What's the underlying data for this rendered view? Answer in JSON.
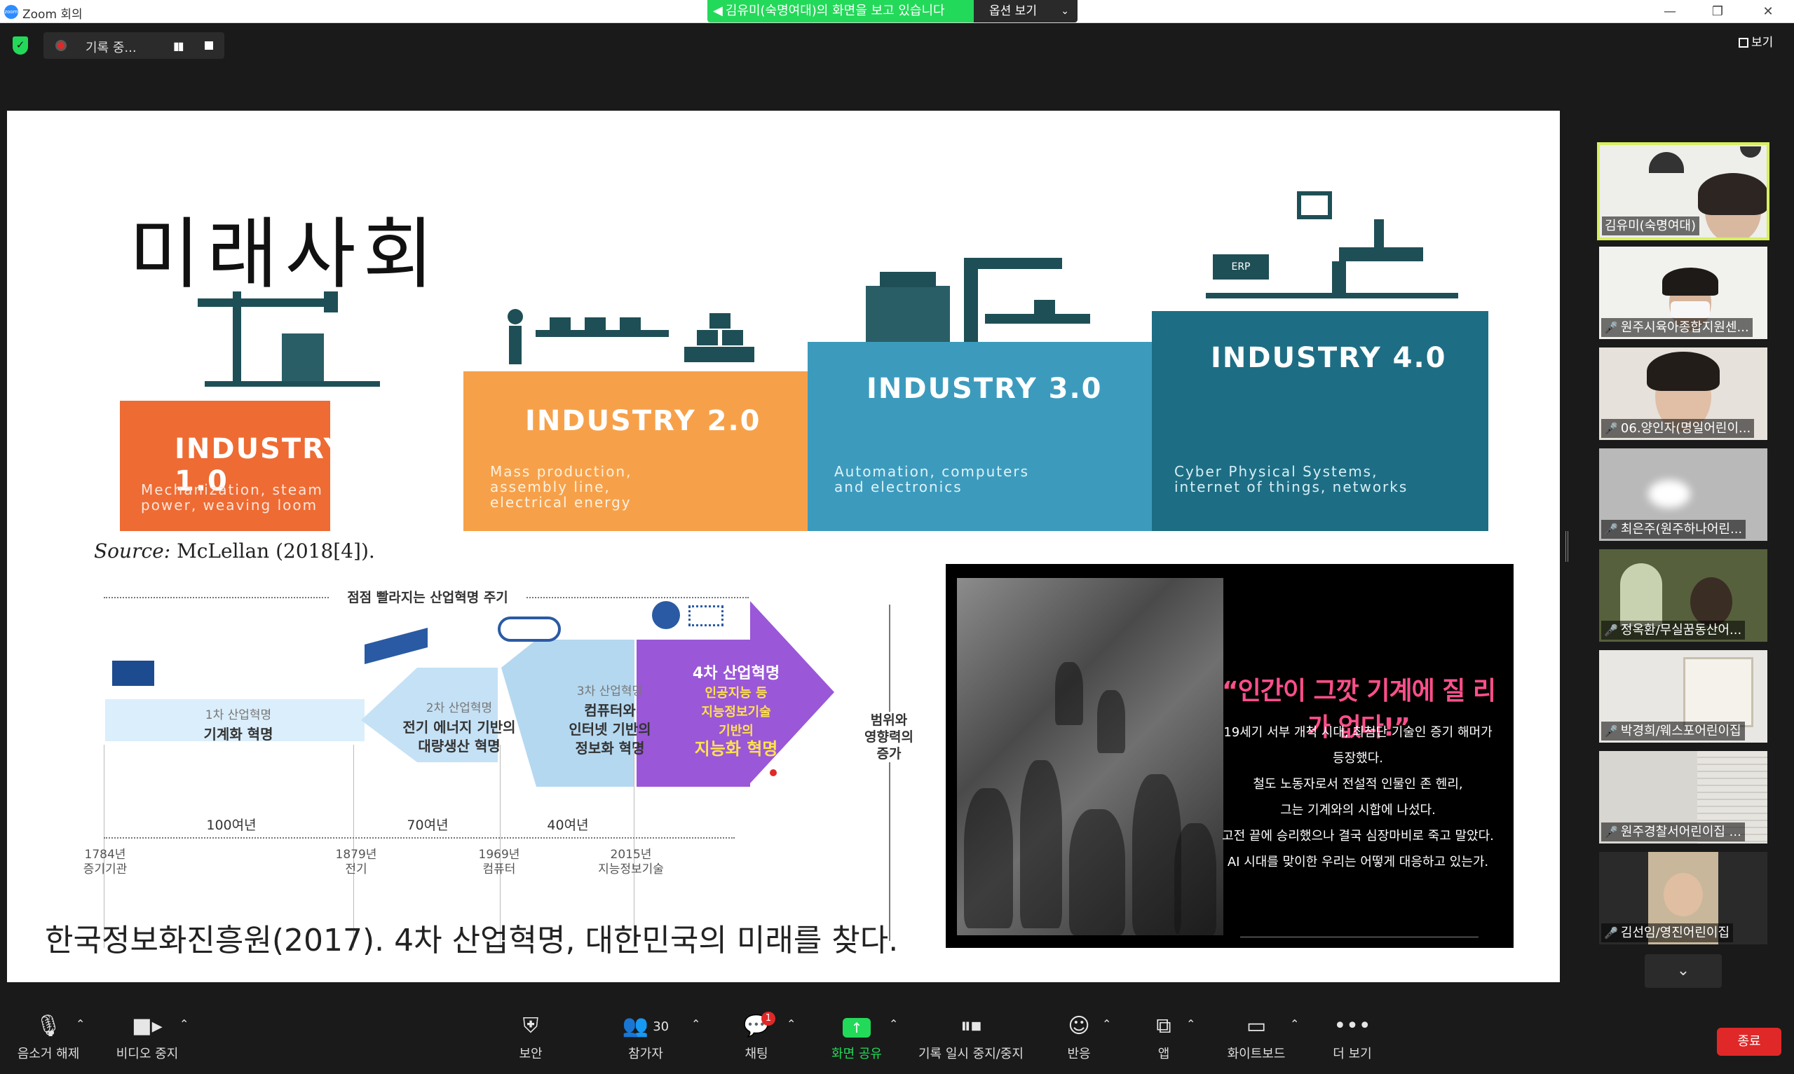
{
  "window": {
    "app_title": "Zoom 회의",
    "logo_text": "zoom",
    "minimize": "—",
    "restore": "❐",
    "close": "✕"
  },
  "share_banner": {
    "text": "김유미(숙명여대)의 화면을 보고 있습니다",
    "view_options": "옵션 보기"
  },
  "recording": {
    "status": "기록 중..."
  },
  "view_button": "보기",
  "slide": {
    "title": "미래사회",
    "industries": [
      {
        "name": "INDUSTRY 1.0",
        "desc_line1": "Mechanization, steam",
        "desc_line2": "power, weaving loom",
        "desc_line3": "",
        "color": "#ee6b33"
      },
      {
        "name": "INDUSTRY 2.0",
        "desc_line1": "Mass production,",
        "desc_line2": "assembly line,",
        "desc_line3": "electrical energy",
        "color": "#f6a14a"
      },
      {
        "name": "INDUSTRY 3.0",
        "desc_line1": "Automation, computers",
        "desc_line2": "and electronics",
        "desc_line3": "",
        "color": "#3c9bbd"
      },
      {
        "name": "INDUSTRY 4.0",
        "desc_line1": "Cyber Physical Systems,",
        "desc_line2": "internet of things, networks",
        "desc_line3": "",
        "color": "#1d6e84"
      }
    ],
    "erp_label": "ERP",
    "source_label": "Source:",
    "source_text": "McLellan (2018[4]).",
    "timeline": {
      "header": "점점 빨라지는 산업혁명 주기",
      "arrow1_sub": "1차 산업혁명",
      "arrow1_main": "기계화 혁명",
      "arrow2_sub": "2차 산업혁명",
      "arrow2_line1": "전기 에너지 기반의",
      "arrow2_line2": "대량생산 혁명",
      "arrow3_sub": "3차 산업혁명",
      "arrow3_line1": "컴퓨터와",
      "arrow3_line2": "인터넷 기반의",
      "arrow3_line3": "정보화 혁명",
      "arrow4_title": "4차 산업혁명",
      "arrow4_line1": "인공지능 등",
      "arrow4_line2": "지능정보기술",
      "arrow4_line3": "기반의",
      "arrow4_main": "지능화 혁명",
      "period1": "100여년",
      "period2": "70여년",
      "period3": "40여년",
      "year1": "1784년",
      "year1_label": "증기기관",
      "year2": "1879년",
      "year2_label": "전기",
      "year3": "1969년",
      "year3_label": "컴퓨터",
      "year4": "2015년",
      "year4_label": "지능정보기술",
      "side_line1": "범위와",
      "side_line2": "영향력의",
      "side_line3": "증가"
    },
    "reference": "한국정보화진흥원(2017). 4차 산업혁명, 대한민국의 미래를 찾다.",
    "photo_quote": "“인간이 그깟 기계에 질 리가 없다!”",
    "photo_body": [
      "19세기 서부 개척 시대, 최첨단 기술인 증기 해머가 등장했다.",
      "철도 노동자로서 전설적 인물인 존 헨리,",
      "그는 기계와의 시합에 나섰다.",
      "고전 끝에 승리했으나 결국 심장마비로 죽고 말았다.",
      "AI 시대를 맞이한 우리는 어떻게 대응하고 있는가."
    ]
  },
  "gallery": [
    {
      "name": "김유미(숙명여대)",
      "muted": false,
      "active": true
    },
    {
      "name": "원주시육아종합지원센...",
      "muted": true,
      "active": false
    },
    {
      "name": "06.양인자(명일어린이...",
      "muted": true,
      "active": false
    },
    {
      "name": "최은주(원주하나어린...",
      "muted": true,
      "active": false
    },
    {
      "name": "정옥환/무실꿈동산어...",
      "muted": true,
      "active": false
    },
    {
      "name": "박경희/웨스포어린이집",
      "muted": true,
      "active": false
    },
    {
      "name": "원주경찰서어린이집 ...",
      "muted": true,
      "active": false
    },
    {
      "name": "김선임/영진어린이집",
      "muted": true,
      "active": false
    }
  ],
  "toolbar": {
    "unmute": "음소거 해제",
    "stop_video": "비디오 중지",
    "security": "보안",
    "participants": "참가자",
    "participant_count": "30",
    "chat": "채팅",
    "chat_badge": "1",
    "share_screen": "화면 공유",
    "pause_stop_recording": "기록 일시 중지/중지",
    "reactions": "반응",
    "apps": "앱",
    "whiteboard": "화이트보드",
    "more": "더 보기",
    "end": "종료"
  },
  "colors": {
    "accent_green": "#23d959",
    "active_speaker": "#d6ef5f",
    "end_red": "#e02828",
    "arrow_purple": "#9a57d8",
    "arrow_blue": "#b4d8f0"
  }
}
